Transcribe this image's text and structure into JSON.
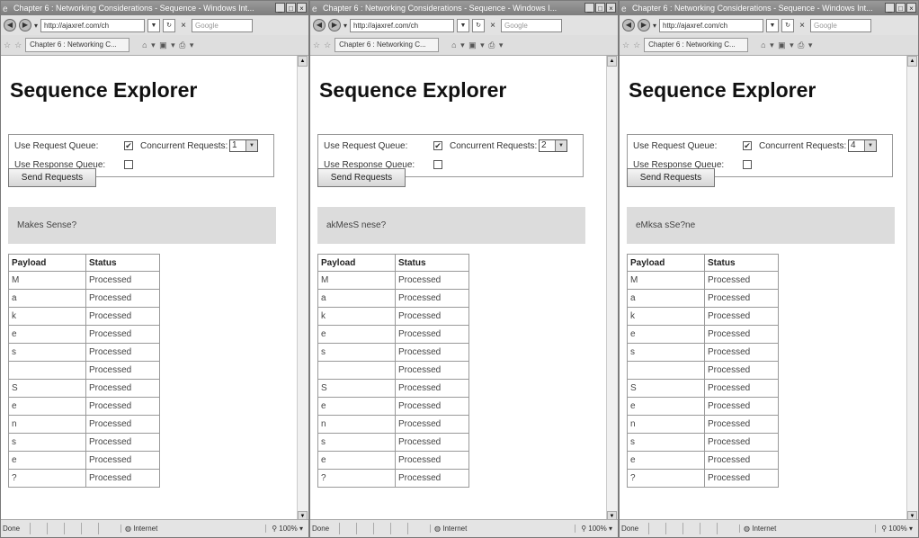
{
  "windows": [
    {
      "title": "Chapter 6 : Networking Considerations - Sequence - Windows Int...",
      "address": "http://ajaxref.com/ch",
      "search_placeholder": "Google",
      "tab_label": "Chapter 6 : Networking C...",
      "page_title": "Sequence Explorer",
      "use_request_queue_label": "Use Request Queue:",
      "use_request_queue_checked": true,
      "use_response_queue_label": "Use Response Queue:",
      "use_response_queue_checked": false,
      "concurrent_label": "Concurrent Requests:",
      "concurrent_value": "1",
      "send_button": "Send Requests",
      "result_text": "Makes Sense?",
      "table_headers": [
        "Payload",
        "Status"
      ],
      "rows": [
        {
          "payload": "M",
          "status": "Processed"
        },
        {
          "payload": "a",
          "status": "Processed"
        },
        {
          "payload": "k",
          "status": "Processed"
        },
        {
          "payload": "e",
          "status": "Processed"
        },
        {
          "payload": "s",
          "status": "Processed"
        },
        {
          "payload": "",
          "status": "Processed"
        },
        {
          "payload": "S",
          "status": "Processed"
        },
        {
          "payload": "e",
          "status": "Processed"
        },
        {
          "payload": "n",
          "status": "Processed"
        },
        {
          "payload": "s",
          "status": "Processed"
        },
        {
          "payload": "e",
          "status": "Processed"
        },
        {
          "payload": "?",
          "status": "Processed"
        }
      ],
      "status_done": "Done",
      "status_zone": "Internet",
      "status_zoom": "100%"
    },
    {
      "title": "Chapter 6 : Networking Considerations - Sequence - Windows I...",
      "address": "http://ajaxref.com/ch",
      "search_placeholder": "Google",
      "tab_label": "Chapter 6 : Networking C...",
      "page_title": "Sequence Explorer",
      "use_request_queue_label": "Use Request Queue:",
      "use_request_queue_checked": true,
      "use_response_queue_label": "Use Response Queue:",
      "use_response_queue_checked": false,
      "concurrent_label": "Concurrent Requests:",
      "concurrent_value": "2",
      "send_button": "Send Requests",
      "result_text": "akMesS nese?",
      "table_headers": [
        "Payload",
        "Status"
      ],
      "rows": [
        {
          "payload": "M",
          "status": "Processed"
        },
        {
          "payload": "a",
          "status": "Processed"
        },
        {
          "payload": "k",
          "status": "Processed"
        },
        {
          "payload": "e",
          "status": "Processed"
        },
        {
          "payload": "s",
          "status": "Processed"
        },
        {
          "payload": "",
          "status": "Processed"
        },
        {
          "payload": "S",
          "status": "Processed"
        },
        {
          "payload": "e",
          "status": "Processed"
        },
        {
          "payload": "n",
          "status": "Processed"
        },
        {
          "payload": "s",
          "status": "Processed"
        },
        {
          "payload": "e",
          "status": "Processed"
        },
        {
          "payload": "?",
          "status": "Processed"
        }
      ],
      "status_done": "Done",
      "status_zone": "Internet",
      "status_zoom": "100%"
    },
    {
      "title": "Chapter 6 : Networking Considerations - Sequence - Windows Int...",
      "address": "http://ajaxref.com/ch",
      "search_placeholder": "Google",
      "tab_label": "Chapter 6 : Networking C...",
      "page_title": "Sequence Explorer",
      "use_request_queue_label": "Use Request Queue:",
      "use_request_queue_checked": true,
      "use_response_queue_label": "Use Response Queue:",
      "use_response_queue_checked": false,
      "concurrent_label": "Concurrent Requests:",
      "concurrent_value": "4",
      "send_button": "Send Requests",
      "result_text": "eMksa sSe?ne",
      "table_headers": [
        "Payload",
        "Status"
      ],
      "rows": [
        {
          "payload": "M",
          "status": "Processed"
        },
        {
          "payload": "a",
          "status": "Processed"
        },
        {
          "payload": "k",
          "status": "Processed"
        },
        {
          "payload": "e",
          "status": "Processed"
        },
        {
          "payload": "s",
          "status": "Processed"
        },
        {
          "payload": "",
          "status": "Processed"
        },
        {
          "payload": "S",
          "status": "Processed"
        },
        {
          "payload": "e",
          "status": "Processed"
        },
        {
          "payload": "n",
          "status": "Processed"
        },
        {
          "payload": "s",
          "status": "Processed"
        },
        {
          "payload": "e",
          "status": "Processed"
        },
        {
          "payload": "?",
          "status": "Processed"
        }
      ],
      "status_done": "Done",
      "status_zone": "Internet",
      "status_zoom": "100%"
    }
  ],
  "icons": {
    "check": "✔",
    "back": "back-arrow-icon",
    "forward": "forward-arrow-icon"
  }
}
